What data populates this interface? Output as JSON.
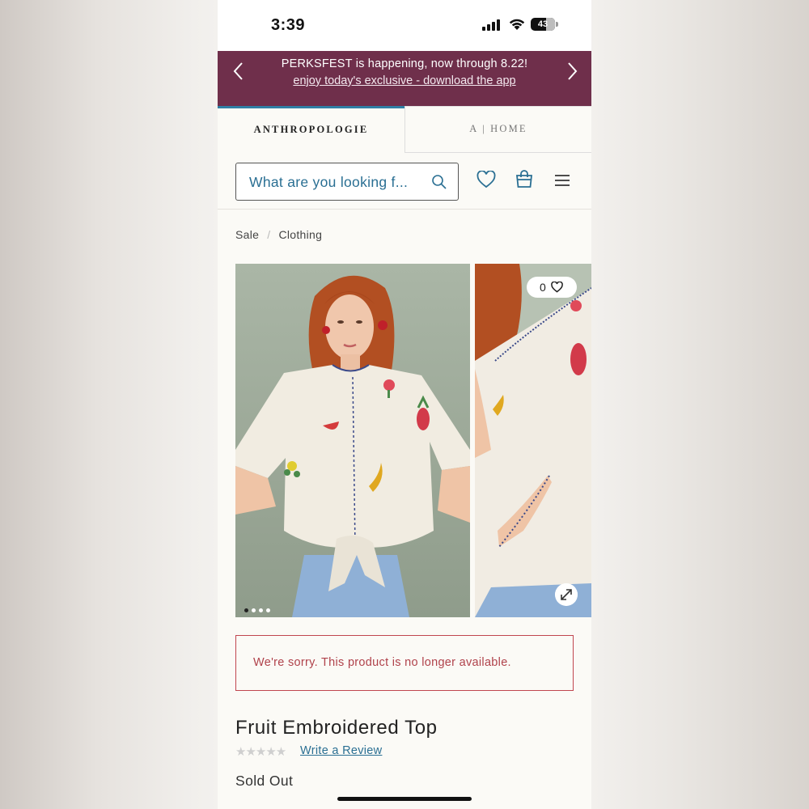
{
  "status_bar": {
    "time": "3:39",
    "battery": "43"
  },
  "promo": {
    "headline": "PERKSFEST is happening, now through 8.22!",
    "link": "enjoy today's exclusive - download the app",
    "bg_color": "#6f2f4b"
  },
  "brand_tabs": {
    "primary": "ANTHROPOLOGIE",
    "secondary": "A | HOME"
  },
  "search": {
    "placeholder": "What are you looking f..."
  },
  "header_icons": [
    "heart-icon",
    "shopping-bag-icon",
    "menu-icon"
  ],
  "breadcrumb": {
    "items": [
      "Sale",
      "Clothing"
    ],
    "separator": "/"
  },
  "gallery": {
    "like_count": "0",
    "dots": 4,
    "active_dot": 0
  },
  "notice": {
    "message": "We're sorry. This product is no longer available."
  },
  "product": {
    "title": "Fruit Embroidered Top",
    "rating_stars": "★★★★★",
    "review_link": "Write a Review",
    "availability": "Sold Out"
  },
  "colors": {
    "accent": "#2a6f93",
    "error": "#c0464f",
    "tab_border": "#2f7fa6"
  }
}
